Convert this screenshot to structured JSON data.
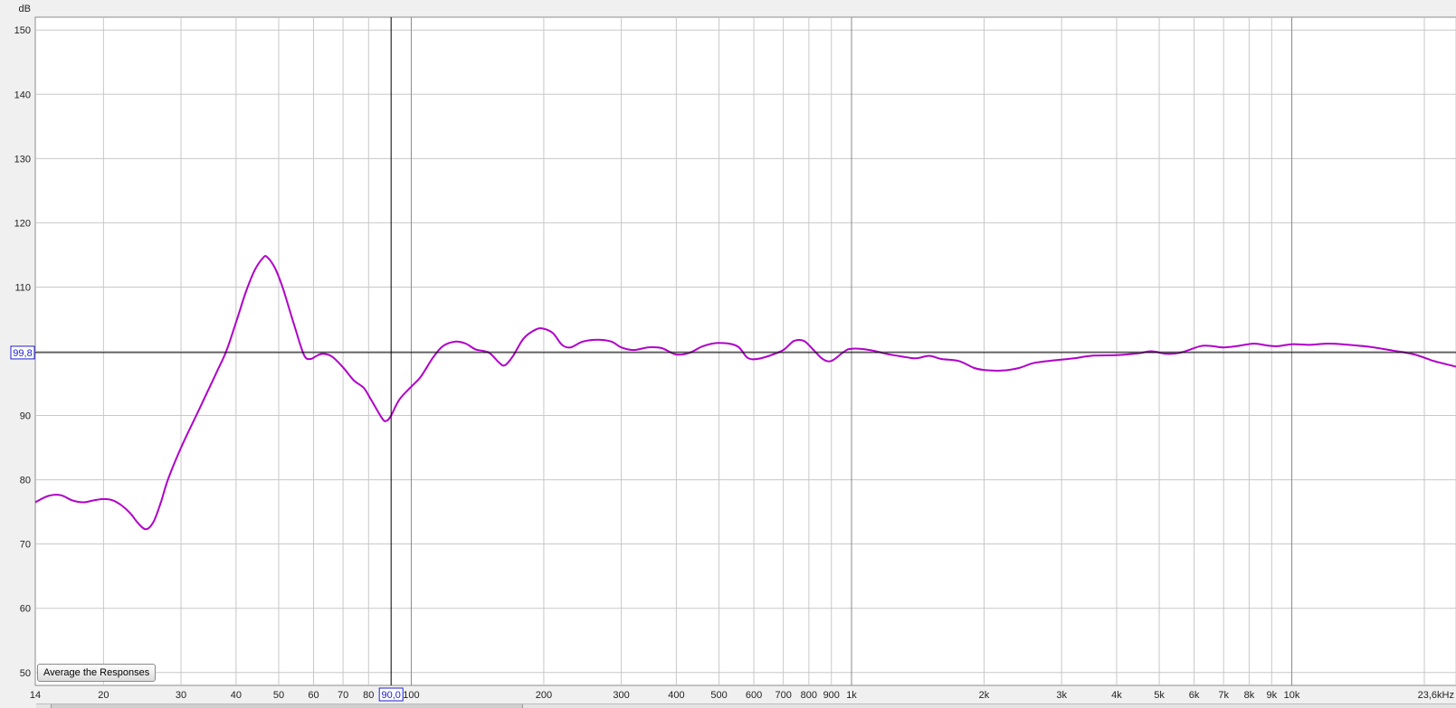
{
  "chart_data": {
    "type": "line",
    "y_unit_label": "dB",
    "x_scale": "log",
    "xlim": [
      14,
      23600
    ],
    "ylim": [
      48,
      152
    ],
    "y_ticks": [
      50,
      60,
      70,
      80,
      90,
      100,
      110,
      120,
      130,
      140,
      150
    ],
    "y_tick_labels": [
      "50",
      "60",
      "70",
      "80",
      "90",
      "",
      "110",
      "120",
      "130",
      "140",
      "150"
    ],
    "x_ticks": [
      {
        "value": 14,
        "label": "14",
        "major": false
      },
      {
        "value": 20,
        "label": "20",
        "major": false
      },
      {
        "value": 30,
        "label": "30",
        "major": false
      },
      {
        "value": 40,
        "label": "40",
        "major": false
      },
      {
        "value": 50,
        "label": "50",
        "major": false
      },
      {
        "value": 60,
        "label": "60",
        "major": false
      },
      {
        "value": 70,
        "label": "70",
        "major": false
      },
      {
        "value": 80,
        "label": "80",
        "major": false
      },
      {
        "value": 100,
        "label": "100",
        "major": true
      },
      {
        "value": 200,
        "label": "200",
        "major": false
      },
      {
        "value": 300,
        "label": "300",
        "major": false
      },
      {
        "value": 400,
        "label": "400",
        "major": false
      },
      {
        "value": 500,
        "label": "500",
        "major": false
      },
      {
        "value": 600,
        "label": "600",
        "major": false
      },
      {
        "value": 700,
        "label": "700",
        "major": false
      },
      {
        "value": 800,
        "label": "800",
        "major": false
      },
      {
        "value": 900,
        "label": "900",
        "major": false
      },
      {
        "value": 1000,
        "label": "1k",
        "major": true
      },
      {
        "value": 2000,
        "label": "2k",
        "major": false
      },
      {
        "value": 3000,
        "label": "3k",
        "major": false
      },
      {
        "value": 4000,
        "label": "4k",
        "major": false
      },
      {
        "value": 5000,
        "label": "5k",
        "major": false
      },
      {
        "value": 6000,
        "label": "6k",
        "major": false
      },
      {
        "value": 7000,
        "label": "7k",
        "major": false
      },
      {
        "value": 8000,
        "label": "8k",
        "major": false
      },
      {
        "value": 9000,
        "label": "9k",
        "major": false
      },
      {
        "value": 10000,
        "label": "10k",
        "major": true
      },
      {
        "value": 20000,
        "label": "",
        "major": false
      },
      {
        "value": 23600,
        "label": "23,6kHz",
        "major": false
      }
    ],
    "grid": true,
    "series": [
      {
        "color": "#b000c8",
        "points": [
          [
            14,
            76.5
          ],
          [
            15,
            77.5
          ],
          [
            16,
            77.6
          ],
          [
            17,
            76.8
          ],
          [
            18,
            76.5
          ],
          [
            19,
            76.8
          ],
          [
            20,
            77.0
          ],
          [
            21,
            76.8
          ],
          [
            22,
            76.0
          ],
          [
            23,
            74.8
          ],
          [
            24,
            73.2
          ],
          [
            25,
            72.3
          ],
          [
            26,
            73.5
          ],
          [
            27,
            76.5
          ],
          [
            28,
            80.0
          ],
          [
            30,
            85.0
          ],
          [
            33,
            91.0
          ],
          [
            36,
            96.5
          ],
          [
            38,
            100.0
          ],
          [
            40,
            104.5
          ],
          [
            42,
            109.0
          ],
          [
            44,
            112.5
          ],
          [
            46,
            114.5
          ],
          [
            47,
            114.7
          ],
          [
            49,
            113.0
          ],
          [
            51,
            110.0
          ],
          [
            54,
            104.5
          ],
          [
            57,
            99.5
          ],
          [
            59,
            98.8
          ],
          [
            61,
            99.3
          ],
          [
            63,
            99.6
          ],
          [
            66,
            99.2
          ],
          [
            70,
            97.5
          ],
          [
            74,
            95.5
          ],
          [
            78,
            94.3
          ],
          [
            81,
            92.5
          ],
          [
            86,
            89.5
          ],
          [
            88,
            89.2
          ],
          [
            90,
            90.0
          ],
          [
            94,
            92.5
          ],
          [
            100,
            94.5
          ],
          [
            105,
            96.0
          ],
          [
            112,
            99.0
          ],
          [
            118,
            100.8
          ],
          [
            126,
            101.5
          ],
          [
            133,
            101.2
          ],
          [
            140,
            100.3
          ],
          [
            150,
            99.8
          ],
          [
            158,
            98.3
          ],
          [
            163,
            97.8
          ],
          [
            170,
            99.2
          ],
          [
            180,
            102.0
          ],
          [
            192,
            103.4
          ],
          [
            200,
            103.5
          ],
          [
            210,
            102.8
          ],
          [
            220,
            101.0
          ],
          [
            230,
            100.6
          ],
          [
            245,
            101.5
          ],
          [
            265,
            101.8
          ],
          [
            285,
            101.5
          ],
          [
            300,
            100.6
          ],
          [
            320,
            100.2
          ],
          [
            345,
            100.6
          ],
          [
            370,
            100.5
          ],
          [
            400,
            99.5
          ],
          [
            430,
            99.8
          ],
          [
            460,
            100.8
          ],
          [
            500,
            101.3
          ],
          [
            550,
            100.8
          ],
          [
            580,
            99.0
          ],
          [
            610,
            98.8
          ],
          [
            650,
            99.3
          ],
          [
            700,
            100.2
          ],
          [
            740,
            101.6
          ],
          [
            780,
            101.6
          ],
          [
            820,
            100.2
          ],
          [
            860,
            98.8
          ],
          [
            900,
            98.5
          ],
          [
            960,
            99.9
          ],
          [
            1000,
            100.4
          ],
          [
            1100,
            100.2
          ],
          [
            1200,
            99.6
          ],
          [
            1300,
            99.2
          ],
          [
            1400,
            98.9
          ],
          [
            1500,
            99.3
          ],
          [
            1600,
            98.8
          ],
          [
            1750,
            98.5
          ],
          [
            1900,
            97.4
          ],
          [
            2000,
            97.1
          ],
          [
            2200,
            97.0
          ],
          [
            2400,
            97.4
          ],
          [
            2600,
            98.2
          ],
          [
            2900,
            98.6
          ],
          [
            3200,
            98.9
          ],
          [
            3500,
            99.3
          ],
          [
            4000,
            99.4
          ],
          [
            4500,
            99.7
          ],
          [
            4800,
            100.0
          ],
          [
            5200,
            99.6
          ],
          [
            5600,
            99.8
          ],
          [
            6200,
            100.8
          ],
          [
            6600,
            100.8
          ],
          [
            7000,
            100.6
          ],
          [
            7500,
            100.8
          ],
          [
            8200,
            101.2
          ],
          [
            8800,
            100.9
          ],
          [
            9300,
            100.8
          ],
          [
            10000,
            101.1
          ],
          [
            11000,
            101.0
          ],
          [
            12000,
            101.2
          ],
          [
            13000,
            101.1
          ],
          [
            15000,
            100.7
          ],
          [
            17000,
            100.1
          ],
          [
            19000,
            99.5
          ],
          [
            21000,
            98.5
          ],
          [
            23000,
            97.8
          ],
          [
            23600,
            97.6
          ]
        ]
      }
    ],
    "cursor": {
      "x": 90.0,
      "y": 99.8,
      "x_label": "90,0",
      "y_label": "99,8"
    }
  },
  "controls": {
    "average_button_label": "Average the Responses"
  }
}
